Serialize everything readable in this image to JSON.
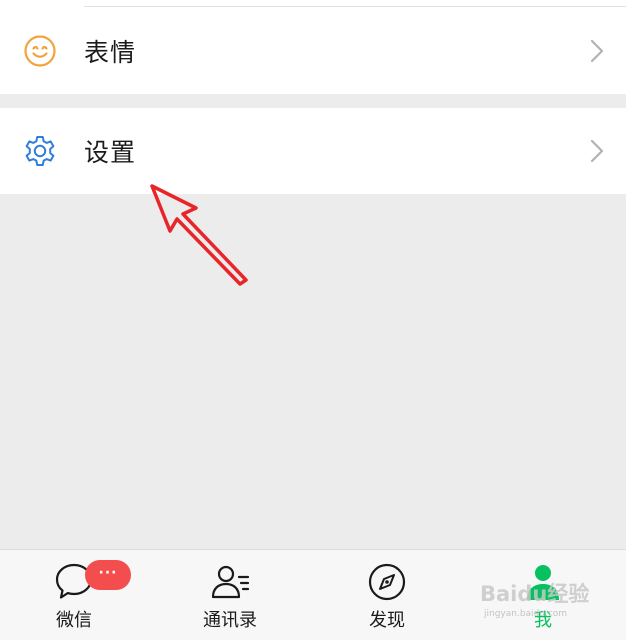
{
  "menu": {
    "emoji": {
      "label": "表情",
      "icon": "smile-icon",
      "icon_color": "#f2a33a"
    },
    "settings": {
      "label": "设置",
      "icon": "gear-icon",
      "icon_color": "#2f7fd6"
    }
  },
  "bottom_nav": {
    "items": [
      {
        "label": "微信",
        "icon": "chat-bubble-icon",
        "active": false,
        "badge": "···"
      },
      {
        "label": "通讯录",
        "icon": "contacts-icon",
        "active": false
      },
      {
        "label": "发现",
        "icon": "compass-icon",
        "active": false
      },
      {
        "label": "我",
        "icon": "person-icon",
        "active": true
      }
    ]
  },
  "watermark": {
    "text": "Baidu经验",
    "url": "jingyan.baidu.com"
  },
  "colors": {
    "active_green": "#07c160",
    "badge_red": "#f34d4d",
    "annotation_red": "#e8262a"
  }
}
